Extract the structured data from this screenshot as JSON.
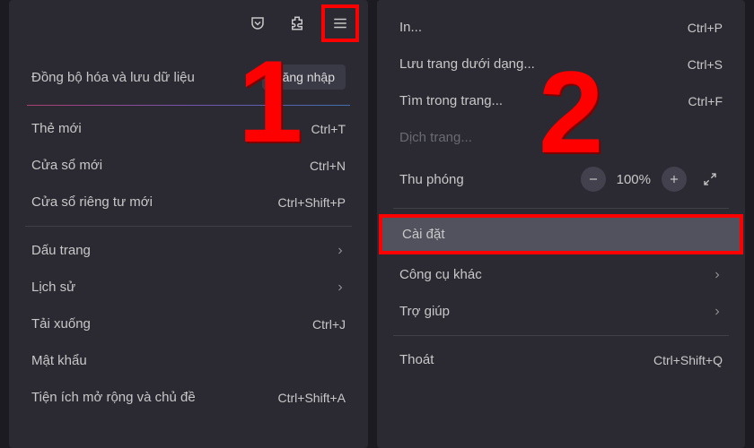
{
  "toolbar": {
    "pocket_icon": "pocket-icon",
    "extensions_icon": "puzzle-icon",
    "hamburger_icon": "hamburger-icon"
  },
  "marker1": "1",
  "marker2": "2",
  "menu_left": {
    "sync_label": "Đồng bộ hóa và lưu dữ liệu",
    "sync_button": "Đăng nhập",
    "items_top": [
      {
        "label": "Thẻ mới",
        "shortcut": "Ctrl+T"
      },
      {
        "label": "Cửa sổ mới",
        "shortcut": "Ctrl+N"
      },
      {
        "label": "Cửa sổ riêng tư mới",
        "shortcut": "Ctrl+Shift+P"
      }
    ],
    "items_mid": [
      {
        "label": "Dấu trang",
        "submenu": true
      },
      {
        "label": "Lịch sử",
        "submenu": true
      },
      {
        "label": "Tải xuống",
        "shortcut": "Ctrl+J"
      },
      {
        "label": "Mật khẩu"
      },
      {
        "label": "Tiện ích mở rộng và chủ đề",
        "shortcut": "Ctrl+Shift+A"
      }
    ]
  },
  "menu_right": {
    "items_top": [
      {
        "label": "In...",
        "shortcut": "Ctrl+P"
      },
      {
        "label": "Lưu trang dưới dạng...",
        "shortcut": "Ctrl+S"
      },
      {
        "label": "Tìm trong trang...",
        "shortcut": "Ctrl+F"
      },
      {
        "label": "Dịch trang...",
        "disabled": true
      }
    ],
    "zoom": {
      "label": "Thu phóng",
      "value": "100%"
    },
    "settings_label": "Cài đặt",
    "items_bottom": [
      {
        "label": "Công cụ khác",
        "submenu": true
      },
      {
        "label": "Trợ giúp",
        "submenu": true
      }
    ],
    "exit": {
      "label": "Thoát",
      "shortcut": "Ctrl+Shift+Q"
    }
  }
}
